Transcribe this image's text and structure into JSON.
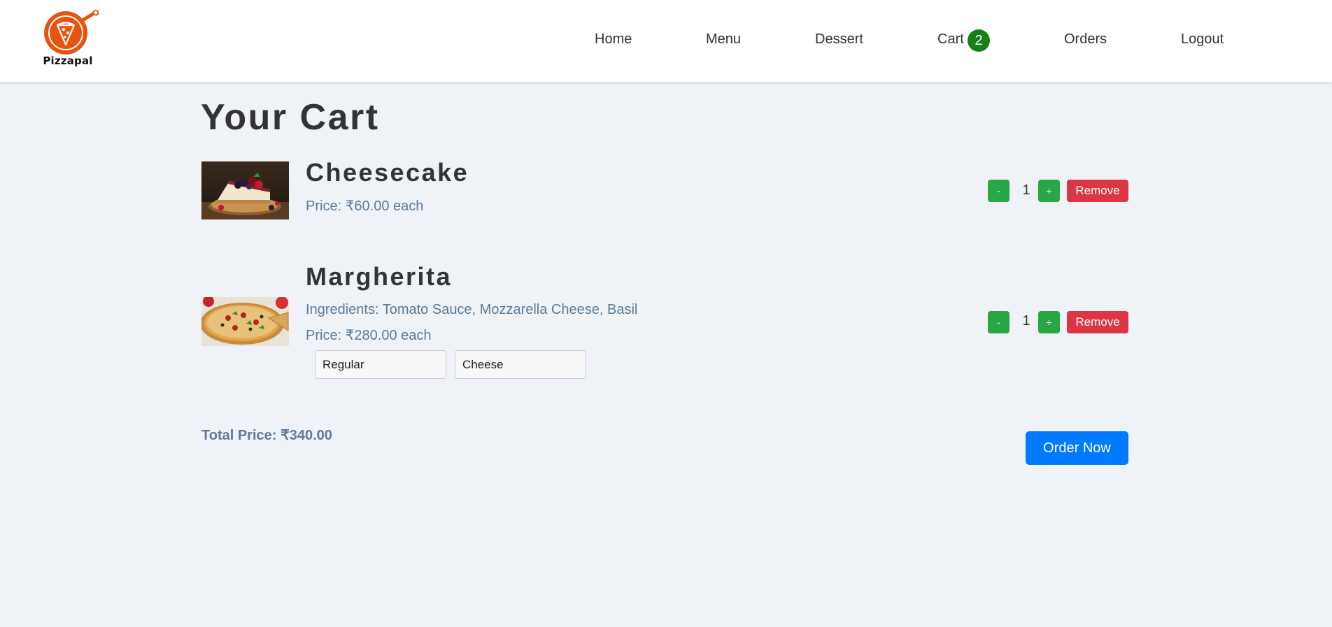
{
  "brand": {
    "name": "Pizzapal",
    "logo_icon": "pizza-pan-icon",
    "color": "#e8540f"
  },
  "nav": {
    "home": "Home",
    "menu": "Menu",
    "dessert": "Dessert",
    "cart": "Cart",
    "cart_count": "2",
    "orders": "Orders",
    "logout": "Logout"
  },
  "page": {
    "title": "Your Cart"
  },
  "cart": {
    "items": [
      {
        "name": "Cheesecake",
        "price_text": "Price: ₹60.00 each",
        "quantity": "1",
        "minus_label": "-",
        "plus_label": "+",
        "remove_label": "Remove",
        "image_icon": "cheesecake-image"
      },
      {
        "name": "Margherita",
        "ingredients_text": "Ingredients: Tomato Sauce, Mozzarella Cheese, Basil",
        "price_text": "Price: ₹280.00 each",
        "size_option": "Regular",
        "crust_option": "Cheese",
        "quantity": "1",
        "minus_label": "-",
        "plus_label": "+",
        "remove_label": "Remove",
        "image_icon": "pizza-image"
      }
    ],
    "total_text": "Total Price: ₹340.00",
    "order_label": "Order Now"
  },
  "colors": {
    "background": "#eff3f7",
    "accent_green": "#28a745",
    "badge_green": "#158017",
    "remove_red": "#dc3545",
    "order_blue": "#007bff",
    "muted_text": "#5c7a96"
  }
}
